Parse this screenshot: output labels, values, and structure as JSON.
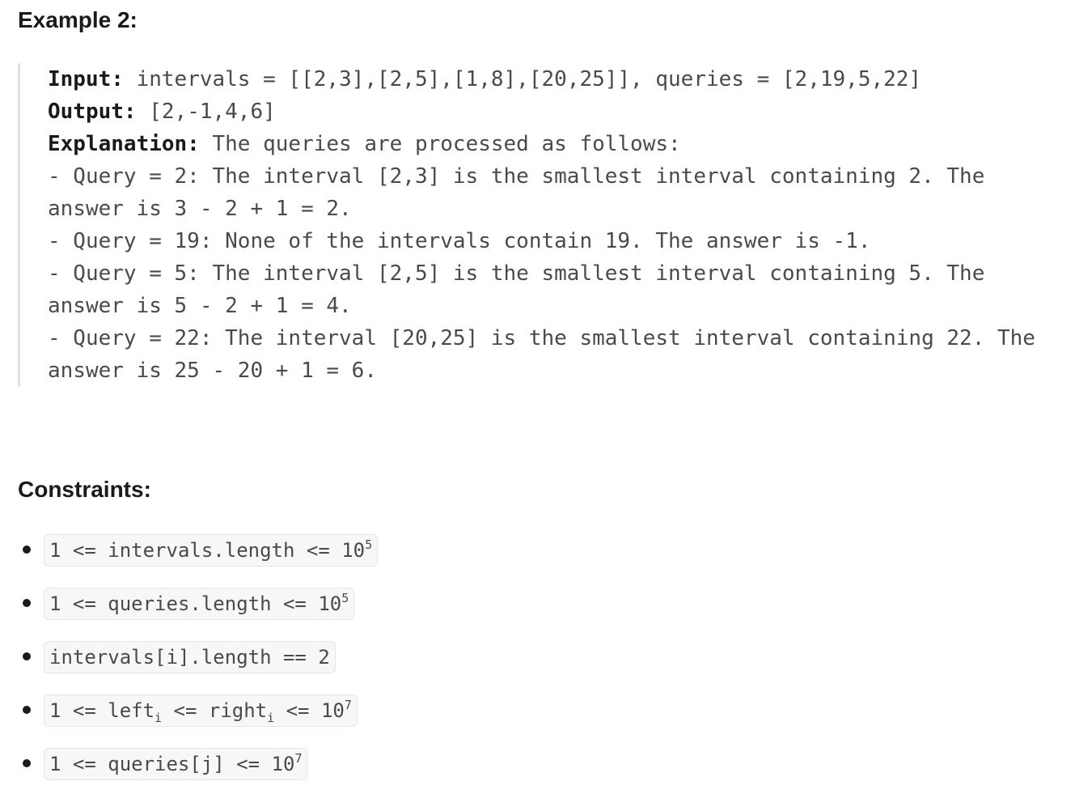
{
  "example": {
    "heading": "Example 2:",
    "input_label": "Input:",
    "input_value": " intervals = [[2,3],[2,5],[1,8],[20,25]], queries = [2,19,5,22]",
    "output_label": "Output:",
    "output_value": " [2,-1,4,6]",
    "explanation_label": "Explanation:",
    "explanation_value": " The queries are processed as follows:",
    "explanation_lines": [
      "- Query = 2: The interval [2,3] is the smallest interval containing 2. The answer is 3 - 2 + 1 = 2.",
      "- Query = 19: None of the intervals contain 19. The answer is -1.",
      "- Query = 5: The interval [2,5] is the smallest interval containing 5. The answer is 5 - 2 + 1 = 4.",
      "- Query = 22: The interval [20,25] is the smallest interval containing 22. The answer is 25 - 20 + 1 = 6."
    ]
  },
  "constraints": {
    "heading": "Constraints:",
    "items": [
      {
        "pre": "1 <= intervals.length <= 10",
        "sup": "5"
      },
      {
        "pre": "1 <= queries.length <= 10",
        "sup": "5"
      },
      {
        "pre": "intervals[i].length == 2"
      },
      {
        "pre": "1 <= left",
        "sub1": "i",
        "mid": " <= right",
        "sub2": "i",
        "post": " <= 10",
        "sup": "7"
      },
      {
        "pre": "1 <= queries[j] <= 10",
        "sup": "7"
      }
    ]
  }
}
